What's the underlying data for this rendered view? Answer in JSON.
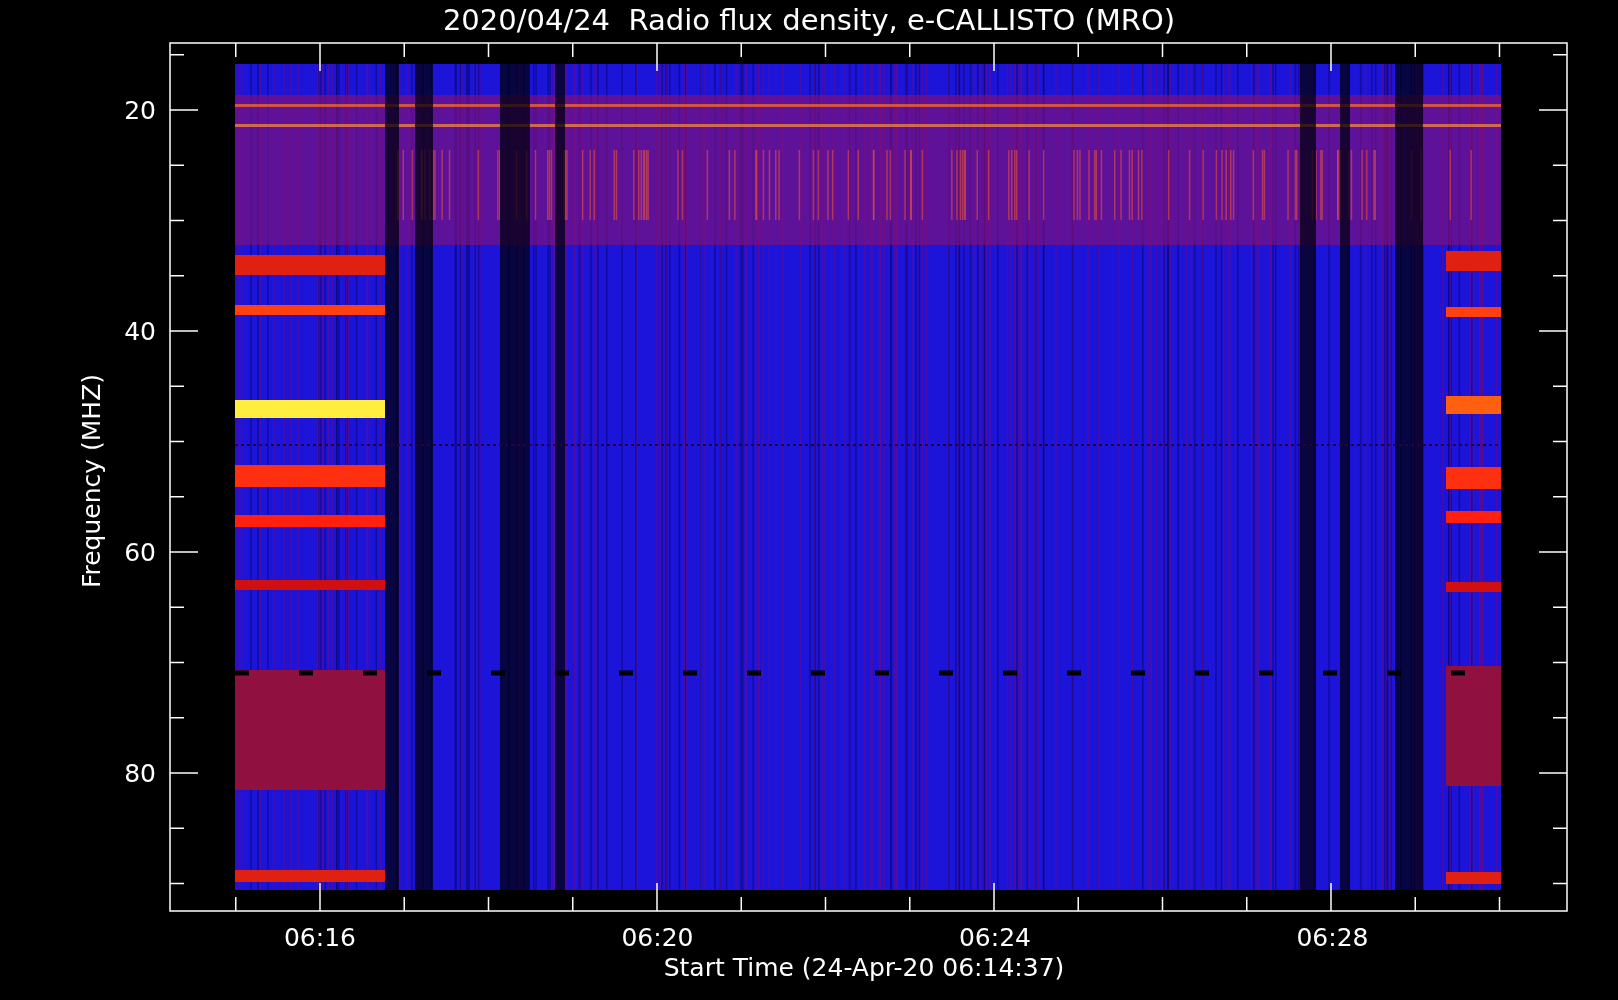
{
  "title": "2020/04/24  Radio flux density, e-CALLISTO (MRO)",
  "y_axis": {
    "label": "Frequency (MHZ)",
    "ticks": [
      "20",
      "40",
      "60",
      "80"
    ]
  },
  "x_axis": {
    "label": "Start Time (24-Apr-20 06:14:37)",
    "ticks": [
      "06:16",
      "06:20",
      "06:24",
      "06:28"
    ]
  }
}
